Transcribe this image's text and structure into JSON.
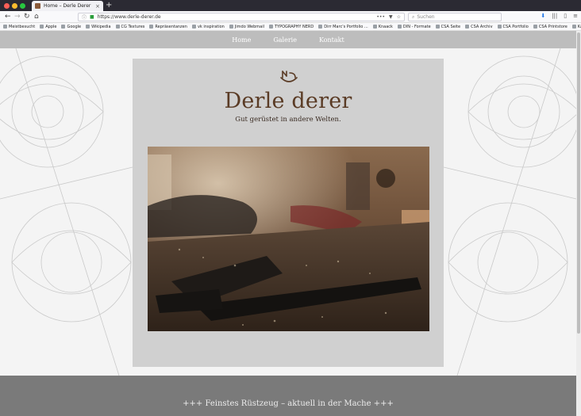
{
  "browser": {
    "tab_title": "Home – Derle Derer",
    "new_tab_symbol": "+",
    "url": "https://www.derle-derer.de",
    "search_placeholder": "Suchen",
    "bookmarks": [
      "Meistbesucht",
      "Apple",
      "Google",
      "Wikipedia",
      "CG Textures",
      "Repräsentanzen",
      "vk inspiration",
      "Jimdo Webmail",
      "TYPOGRAPHY NERD",
      "Dirr Marc's Portfolio ...",
      "Knaack",
      "DIN - Formate",
      "CSA Seite",
      "CSA Archiv",
      "CSA Portfolio",
      "CSA Printstore",
      "Kata"
    ],
    "colors": {
      "accent_green": "#2a9d3a",
      "download_blue": "#1a73e8"
    }
  },
  "site": {
    "nav": [
      "Home",
      "Galerie",
      "Kontakt"
    ],
    "logo_text": "Derle derer",
    "tagline": "Gut gerüstet in andere Welten.",
    "footer_text": "+++ Feinstes Rüstzeug – aktuell in der Mache +++",
    "colors": {
      "brand_brown": "#5a3b25",
      "nav_bg": "#bdbdbd",
      "footer_bg": "#7a7a7a"
    }
  },
  "icons": [
    "back-icon",
    "forward-icon",
    "reload-icon",
    "home-icon",
    "lock-icon",
    "bookmark-star-icon",
    "download-icon",
    "library-icon",
    "sidebar-icon",
    "menu-icon",
    "logo-helmet-icon"
  ]
}
